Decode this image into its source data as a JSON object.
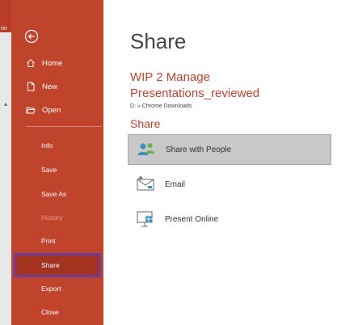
{
  "edge": {
    "label": "on"
  },
  "nav": {
    "top_items": [
      {
        "label": "Home",
        "icon": "home-icon"
      },
      {
        "label": "New",
        "icon": "new-document-icon"
      },
      {
        "label": "Open",
        "icon": "folder-open-icon"
      }
    ],
    "items": [
      {
        "label": "Info"
      },
      {
        "label": "Save"
      },
      {
        "label": "Save As"
      },
      {
        "label": "History",
        "disabled": true
      },
      {
        "label": "Print"
      },
      {
        "label": "Share",
        "selected": true
      },
      {
        "label": "Export"
      },
      {
        "label": "Close"
      }
    ]
  },
  "main": {
    "title": "Share",
    "document": {
      "name": "WIP 2 Manage Presentations_reviewed",
      "path": "D: » Chrome Downloads"
    },
    "section_heading": "Share",
    "options": [
      {
        "label": "Share with People",
        "icon": "people-icon",
        "selected": true
      },
      {
        "label": "Email",
        "icon": "email-icon"
      },
      {
        "label": "Present Online",
        "icon": "present-online-icon"
      }
    ]
  },
  "colors": {
    "accent": "#c0432c",
    "selected_nav": "#a3321f",
    "selection_outline": "#6a3ea1",
    "selected_option": "#c8c8c8"
  }
}
